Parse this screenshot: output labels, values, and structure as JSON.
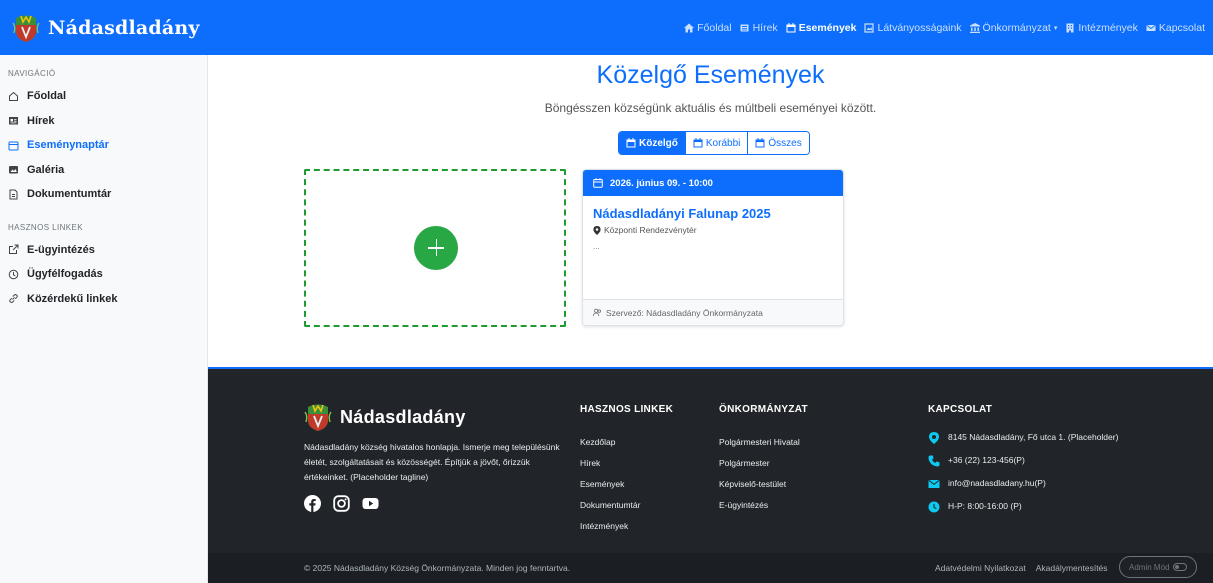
{
  "header": {
    "brand": "Nádasdladány",
    "nav": [
      {
        "label": "Főoldal",
        "icon": "home-icon"
      },
      {
        "label": "Hírek",
        "icon": "newspaper-icon"
      },
      {
        "label": "Események",
        "icon": "calendar-icon",
        "active": true
      },
      {
        "label": "Látványosságaink",
        "icon": "landmark-icon"
      },
      {
        "label": "Önkormányzat",
        "icon": "bank-icon",
        "dropdown": true
      },
      {
        "label": "Intézmények",
        "icon": "building-icon"
      },
      {
        "label": "Kapcsolat",
        "icon": "envelope-icon"
      }
    ]
  },
  "sidebar": {
    "nav_heading": "NAVIGÁCIÓ",
    "nav_items": [
      {
        "label": "Főoldal",
        "icon": "home-icon"
      },
      {
        "label": "Hírek",
        "icon": "newspaper-icon"
      },
      {
        "label": "Eseménynaptár",
        "icon": "calendar-icon",
        "active": true
      },
      {
        "label": "Galéria",
        "icon": "image-icon"
      },
      {
        "label": "Dokumentumtár",
        "icon": "document-icon"
      }
    ],
    "links_heading": "HASZNOS LINKEK",
    "link_items": [
      {
        "label": "E-ügyintézés",
        "icon": "external-link-icon"
      },
      {
        "label": "Ügyfélfogadás",
        "icon": "clock-icon"
      },
      {
        "label": "Közérdekű linkek",
        "icon": "link-icon"
      }
    ]
  },
  "main": {
    "title": "Közelgő Események",
    "subtitle": "Böngésszen községünk aktuális és múltbeli eseményei között.",
    "filters": [
      {
        "label": "Közelgő",
        "active": true
      },
      {
        "label": "Korábbi",
        "active": false
      },
      {
        "label": "Összes",
        "active": false
      }
    ],
    "event": {
      "date": "2026. június 09. - 10:00",
      "title": "Nádasdladányi Falunap 2025",
      "location": "Központi Rendezvénytér",
      "description": "...",
      "organizer": "Szervező: Nádasdladány Önkormányzata"
    }
  },
  "footer": {
    "brand": "Nádasdladány",
    "tagline": "Nádasdladány község hivatalos honlapja. Ismerje meg településünk életét, szolgáltatásait és közösségét. Építjük a jövőt, őrizzük értékeinket. (Placeholder tagline)",
    "social": [
      "facebook-icon",
      "instagram-icon",
      "youtube-icon"
    ],
    "useful_links": {
      "heading": "HASZNOS LINKEK",
      "items": [
        "Kezdőlap",
        "Hírek",
        "Események",
        "Dokumentumtár",
        "Intézmények"
      ]
    },
    "municipality": {
      "heading": "ÖNKORMÁNYZAT",
      "items": [
        "Polgármesteri Hivatal",
        "Polgármester",
        "Képviselő-testület",
        "E-ügyintézés"
      ]
    },
    "contact": {
      "heading": "KAPCSOLAT",
      "address": "8145 Nádasdladány, Fő utca 1. (Placeholder)",
      "phone": "+36 (22) 123-456(P)",
      "email": "info@nadasdladany.hu(P)",
      "hours": "H-P: 8:00-16:00 (P)"
    },
    "copyright": "© 2025 Nádasdladány Község Önkormányzata. Minden jog fenntartva.",
    "privacy": "Adatvédelmi Nyilatkozat",
    "accessibility": "Akadálymentesítés",
    "admin": "Admin Mód"
  },
  "colors": {
    "primary": "#0d6efd",
    "success": "#28a745",
    "footer_bg": "#212529",
    "contact_icon": "#0dcaf0"
  }
}
